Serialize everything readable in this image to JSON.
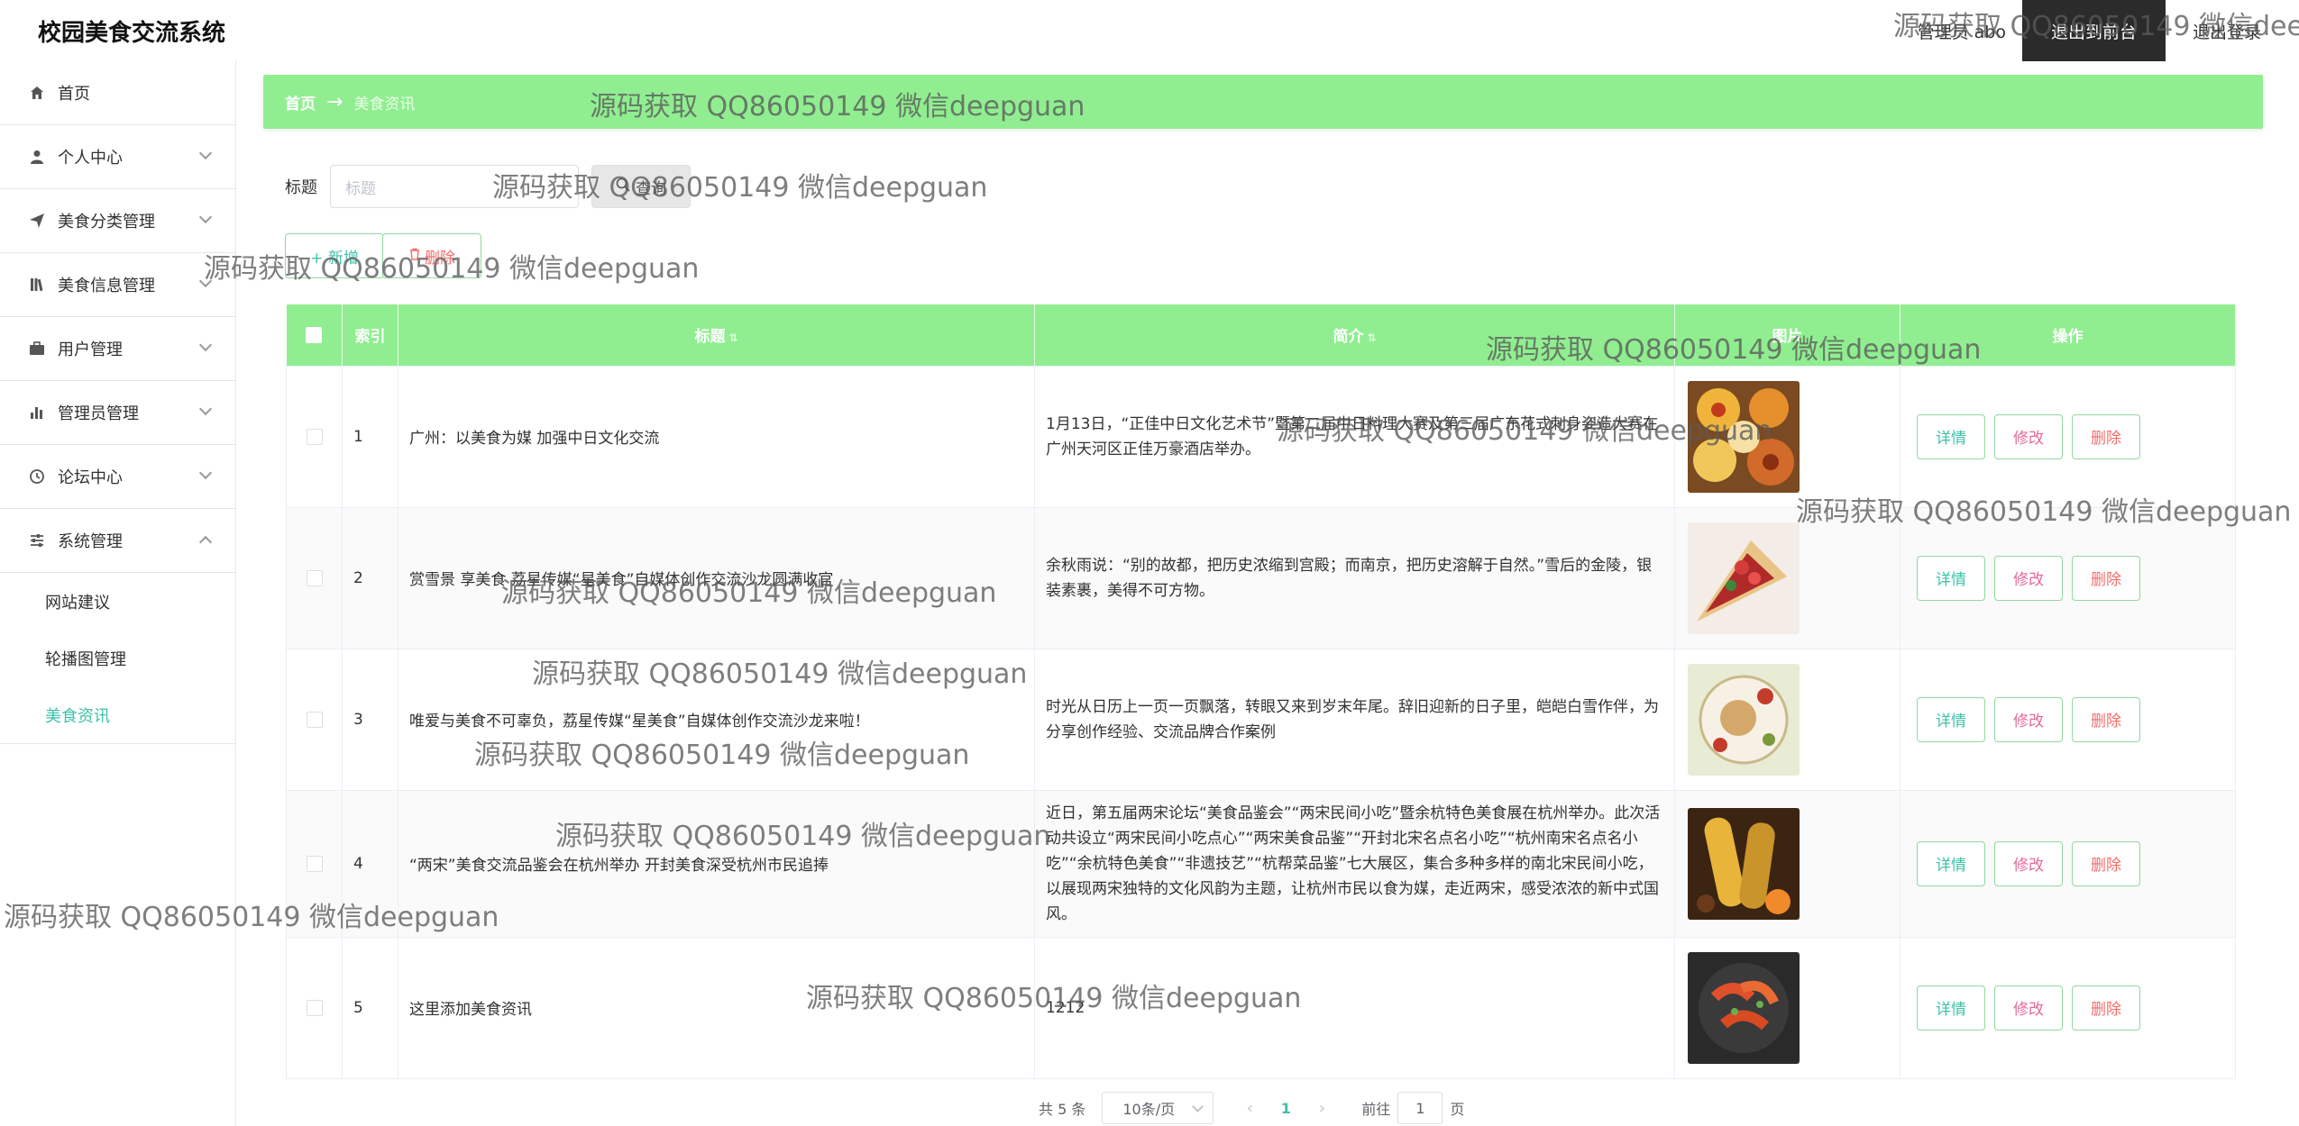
{
  "app": {
    "title": "校园美食交流系统"
  },
  "topbar": {
    "user": "管理员 abo",
    "front_button": "退出到前台",
    "logout": "退出登录"
  },
  "sidebar": {
    "items": [
      {
        "label": "首页",
        "icon": "home-icon"
      },
      {
        "label": "个人中心",
        "icon": "user-icon"
      },
      {
        "label": "美食分类管理",
        "icon": "send-icon"
      },
      {
        "label": "美食信息管理",
        "icon": "library-icon"
      },
      {
        "label": "用户管理",
        "icon": "briefcase-icon"
      },
      {
        "label": "管理员管理",
        "icon": "bar-chart-icon"
      },
      {
        "label": "论坛中心",
        "icon": "clock-icon"
      },
      {
        "label": "系统管理",
        "icon": "sliders-icon"
      }
    ],
    "sub_items": [
      {
        "label": "网站建议"
      },
      {
        "label": "轮播图管理"
      },
      {
        "label": "美食资讯"
      }
    ]
  },
  "breadcrumb": {
    "home": "首页",
    "arrow": "→",
    "current": "美食资讯"
  },
  "search": {
    "label": "标题",
    "placeholder": "标题",
    "button": "查询"
  },
  "actions": {
    "add": "+ 新增",
    "delete": "删除"
  },
  "table": {
    "headers": {
      "index": "索引",
      "title": "标题",
      "intro": "简介",
      "image": "图片",
      "ops": "操作"
    },
    "op_labels": {
      "detail": "详情",
      "edit": "修改",
      "remove": "删除"
    },
    "rows": [
      {
        "index": "1",
        "title": "广州：以美食为媒 加强中日文化交流",
        "intro": "1月13日，“正佳中日文化艺术节”暨第二届中日料理大赛及第三届广东花式刺身姿造大赛在广州天河区正佳万豪酒店举办。"
      },
      {
        "index": "2",
        "title": "赏雪景 享美食 荔星传媒“星美食”自媒体创作交流沙龙圆满收官",
        "intro": "余秋雨说：“别的故都，把历史浓缩到宫殿；而南京，把历史溶解于自然。”雪后的金陵，银装素裹，美得不可方物。"
      },
      {
        "index": "3",
        "title": "唯爱与美食不可辜负，荔星传媒“星美食”自媒体创作交流沙龙来啦！",
        "intro": "时光从日历上一页一页飘落，转眼又来到岁末年尾。辞旧迎新的日子里，皑皑白雪作伴，为分享创作经验、交流品牌合作案例"
      },
      {
        "index": "4",
        "title": "“两宋”美食交流品鉴会在杭州举办 开封美食深受杭州市民追捧",
        "intro": "近日，第五届两宋论坛“美食品鉴会”“两宋民间小吃”暨余杭特色美食展在杭州举办。此次活动共设立“两宋民间小吃点心”“两宋美食品鉴”“开封北宋名点名小吃”“杭州南宋名点名小吃”“余杭特色美食”“非遗技艺”“杭帮菜品鉴”七大展区，集合多种多样的南北宋民间小吃，以展现两宋独特的文化风韵为主题，让杭州市民以食为媒，走近两宋，感受浓浓的新中式国风。"
      },
      {
        "index": "5",
        "title": "这里添加美食资讯",
        "intro": "1212"
      }
    ]
  },
  "pagination": {
    "total": "共 5 条",
    "page_size": "10条/页",
    "prev": "‹",
    "current_page": "1",
    "next": "›",
    "goto_label": "前往",
    "goto_value": "1",
    "goto_suffix": "页"
  },
  "watermark": {
    "text": "源码获取 QQ86050149 微信deepguan"
  },
  "colors": {
    "accent_green": "#90ee90",
    "teal": "#3ec1a9",
    "danger": "#f56c6c",
    "dark_button": "#2b2b2b"
  }
}
